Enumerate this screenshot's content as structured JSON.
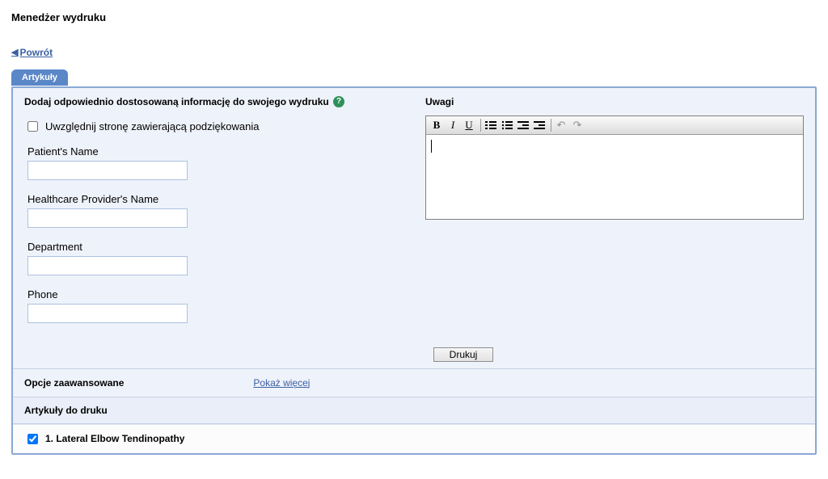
{
  "page": {
    "title": "Menedżer wydruku",
    "back_label": "Powrót",
    "tab_label": "Artykuły"
  },
  "custom_info": {
    "heading": "Dodaj odpowiednio dostosowaną informację do swojego wydruku",
    "include_thanks_label": "Uwzględnij stronę zawierającą podziękowania",
    "include_thanks_checked": false,
    "fields": {
      "patient_name": {
        "label": "Patient's Name",
        "value": ""
      },
      "provider_name": {
        "label": "Healthcare Provider's Name",
        "value": ""
      },
      "department": {
        "label": "Department",
        "value": ""
      },
      "phone": {
        "label": "Phone",
        "value": ""
      }
    }
  },
  "remarks": {
    "heading": "Uwagi",
    "value": ""
  },
  "toolbar": {
    "bold": "B",
    "italic": "I",
    "underline": "U"
  },
  "actions": {
    "print_label": "Drukuj"
  },
  "advanced": {
    "heading": "Opcje zaawansowane",
    "toggle_label": "Pokaż więcej"
  },
  "articles": {
    "heading": "Artykuły do druku",
    "items": [
      {
        "checked": true,
        "label": "1. Lateral Elbow Tendinopathy"
      }
    ]
  }
}
